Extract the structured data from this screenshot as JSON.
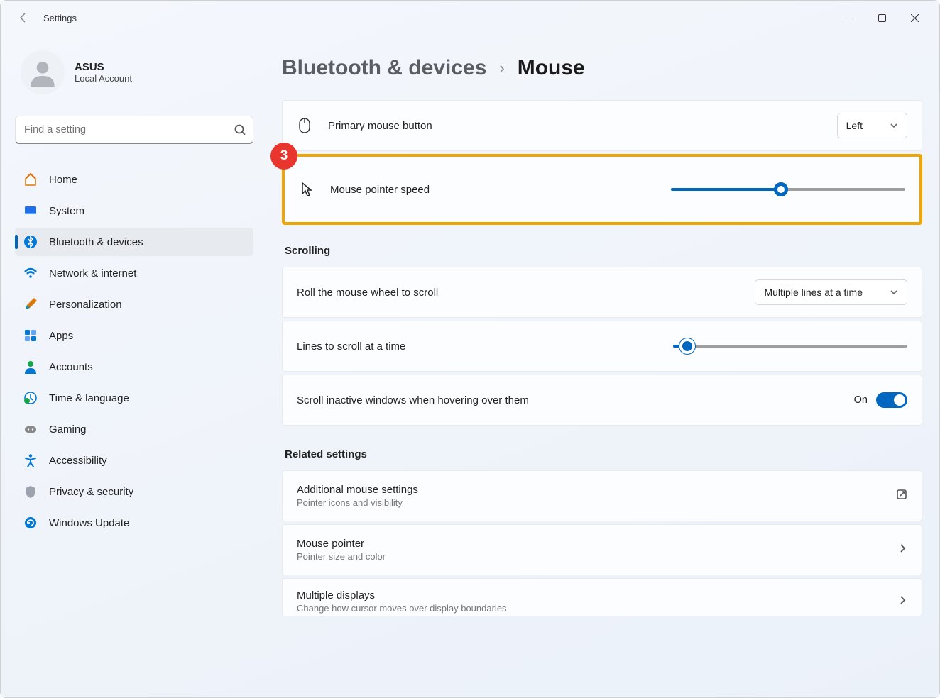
{
  "app_title": "Settings",
  "profile": {
    "name": "ASUS",
    "subtitle": "Local Account"
  },
  "search": {
    "placeholder": "Find a setting"
  },
  "nav": {
    "home": "Home",
    "system": "System",
    "bluetooth": "Bluetooth & devices",
    "network": "Network & internet",
    "personalization": "Personalization",
    "apps": "Apps",
    "accounts": "Accounts",
    "time_lang": "Time & language",
    "gaming": "Gaming",
    "accessibility": "Accessibility",
    "privacy": "Privacy & security",
    "update": "Windows Update"
  },
  "breadcrumb": {
    "parent": "Bluetooth & devices",
    "current": "Mouse"
  },
  "rows": {
    "primary_button": {
      "label": "Primary mouse button",
      "value": "Left"
    },
    "pointer_speed": {
      "label": "Mouse pointer speed",
      "slider_pct": 47
    },
    "scroll_head": "Scrolling",
    "wheel_scroll": {
      "label": "Roll the mouse wheel to scroll",
      "value": "Multiple lines at a time"
    },
    "lines_scroll": {
      "label": "Lines to scroll at a time",
      "slider_pct": 6
    },
    "inactive": {
      "label": "Scroll inactive windows when hovering over them",
      "state": "On"
    },
    "related_head": "Related settings",
    "additional": {
      "title": "Additional mouse settings",
      "sub": "Pointer icons and visibility"
    },
    "pointer": {
      "title": "Mouse pointer",
      "sub": "Pointer size and color"
    },
    "displays": {
      "title": "Multiple displays",
      "sub": "Change how cursor moves over display boundaries"
    }
  },
  "annotation": {
    "step": "3"
  }
}
